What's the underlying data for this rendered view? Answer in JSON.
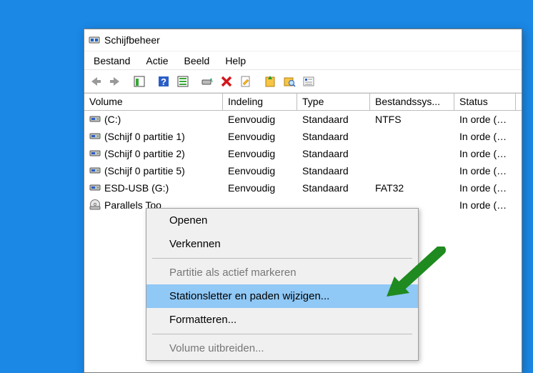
{
  "window": {
    "title": "Schijfbeheer"
  },
  "menubar": [
    "Bestand",
    "Actie",
    "Beeld",
    "Help"
  ],
  "columns": [
    "Volume",
    "Indeling",
    "Type",
    "Bestandssys...",
    "Status"
  ],
  "rows": [
    {
      "icon": "vol",
      "name": "(C:)",
      "fmt": "Eenvoudig",
      "type": "Standaard",
      "fs": "NTFS",
      "status": "In orde (O..."
    },
    {
      "icon": "vol",
      "name": "(Schijf 0 partitie 1)",
      "fmt": "Eenvoudig",
      "type": "Standaard",
      "fs": "",
      "status": "In orde (H..."
    },
    {
      "icon": "vol",
      "name": "(Schijf 0 partitie 2)",
      "fmt": "Eenvoudig",
      "type": "Standaard",
      "fs": "",
      "status": "In orde (E..."
    },
    {
      "icon": "vol",
      "name": "(Schijf 0 partitie 5)",
      "fmt": "Eenvoudig",
      "type": "Standaard",
      "fs": "",
      "status": "In orde (H..."
    },
    {
      "icon": "vol",
      "name": "ESD-USB (G:)",
      "fmt": "Eenvoudig",
      "type": "Standaard",
      "fs": "FAT32",
      "status": "In orde (A..."
    },
    {
      "icon": "cd",
      "name": "Parallels Too",
      "fmt": "",
      "type": "",
      "fs": "",
      "status": "In orde (Pr..."
    }
  ],
  "context": {
    "items": [
      {
        "label": "Openen",
        "disabled": false,
        "highlight": false
      },
      {
        "label": "Verkennen",
        "disabled": false,
        "highlight": false
      },
      {
        "sep": true
      },
      {
        "label": "Partitie als actief markeren",
        "disabled": true,
        "highlight": false
      },
      {
        "label": "Stationsletter en paden wijzigen...",
        "disabled": false,
        "highlight": true
      },
      {
        "label": "Formatteren...",
        "disabled": false,
        "highlight": false
      },
      {
        "sep": true
      },
      {
        "label": "Volume uitbreiden...",
        "disabled": true,
        "highlight": false
      }
    ]
  }
}
